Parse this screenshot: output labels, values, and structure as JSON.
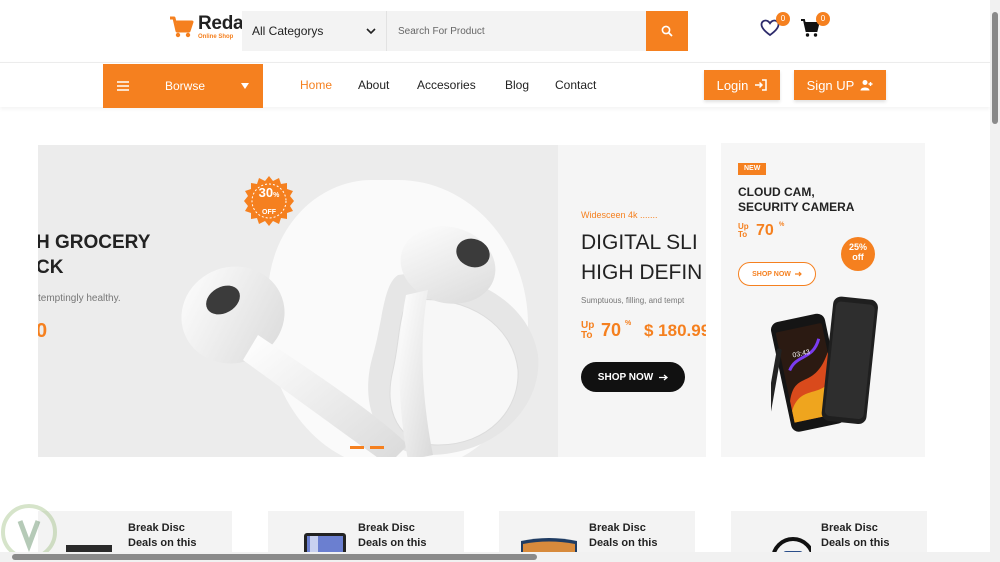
{
  "header": {
    "logo_name": "Reda",
    "logo_sub": "Online Shop",
    "category_select": "All Categorys",
    "search_placeholder": "Search For Product",
    "wishlist_count": "0",
    "cart_count": "0"
  },
  "nav": {
    "browse_label": "Borwse",
    "links": [
      "Home",
      "About",
      "Accesories",
      "Blog",
      "Contact"
    ],
    "active": "Home",
    "login_label": "Login",
    "signup_label": "Sign UP"
  },
  "hero": {
    "slide_a": {
      "title_line1": "H GROCERY",
      "title_line2": "CK",
      "subtitle": "temptingly healthy.",
      "price_fragment": "0",
      "badge_value": "30",
      "badge_pct": "%",
      "badge_off": "OFF"
    },
    "slide_b": {
      "kicker": "Widesceen 4k .......",
      "title_line1": "DIGITAL SLI",
      "title_line2": "HIGH DEFIN",
      "subtitle": "Sumptuous, filling, and tempt",
      "upto_line1": "Up",
      "upto_line2": "To",
      "discount": "70",
      "discount_pct": "%",
      "price": "$ 180.99",
      "button": "SHOP NOW"
    }
  },
  "side_card": {
    "badge": "NEW",
    "title_line1": "CLOUD CAM,",
    "title_line2": "SECURITY CAMERA",
    "upto_line1": "Up",
    "upto_line2": "To",
    "discount": "70",
    "discount_pct": "%",
    "button": "SHOP NOW",
    "circle_value": "25%",
    "circle_off": "off",
    "phone_time": "03:43"
  },
  "deals": [
    {
      "line1": "Break Disc",
      "line2": "Deals on this"
    },
    {
      "line1": "Break Disc",
      "line2": "Deals on this"
    },
    {
      "line1": "Break Disc",
      "line2": "Deals on this"
    },
    {
      "line1": "Break Disc",
      "line2": "Deals on this"
    }
  ],
  "colors": {
    "accent": "#f5801f",
    "dark": "#111111",
    "text": "#222222"
  }
}
